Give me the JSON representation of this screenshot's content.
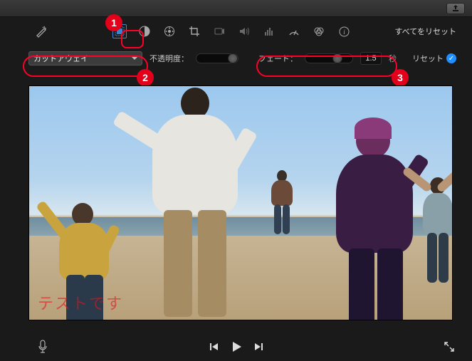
{
  "toolbar": {
    "reset_all": "すべてをリセット"
  },
  "controls": {
    "overlay_mode": "カットアウェイ",
    "opacity_label": "不透明度：",
    "fade_label": "フェード：",
    "fade_value": "1.5",
    "fade_unit": "秒",
    "reset_label": "リセット"
  },
  "preview": {
    "overlay_text": "テストです"
  },
  "annotations": {
    "badge1": "1",
    "badge2": "2",
    "badge3": "3"
  }
}
